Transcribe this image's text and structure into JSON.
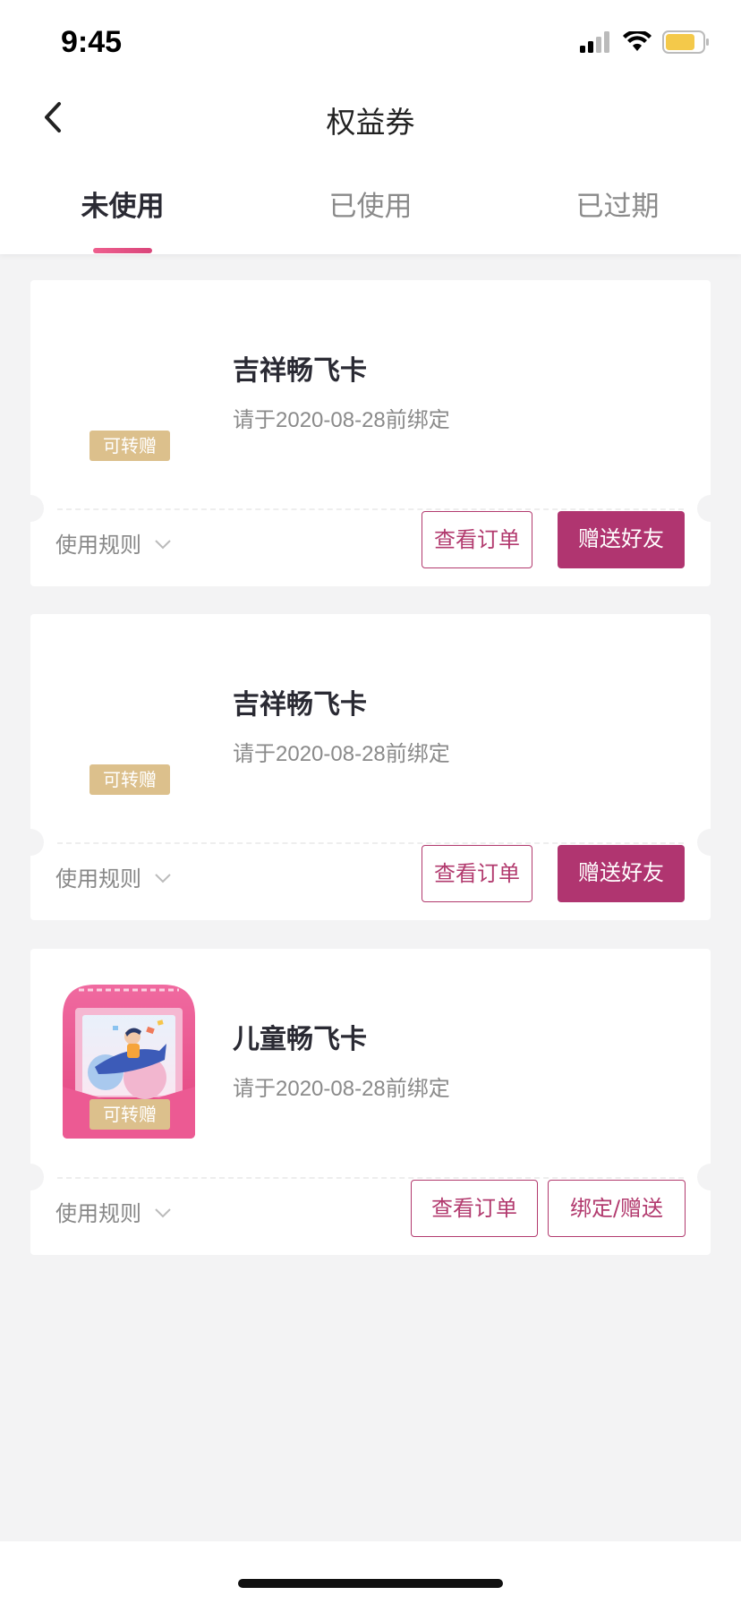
{
  "status": {
    "time": "9:45"
  },
  "header": {
    "title": "权益券"
  },
  "tabs": [
    {
      "label": "未使用",
      "active": true
    },
    {
      "label": "已使用",
      "active": false
    },
    {
      "label": "已过期",
      "active": false
    }
  ],
  "cards": [
    {
      "name": "吉祥畅飞卡",
      "date": "请于2020-08-28前绑定",
      "badge": "可转赠",
      "rules": "使用规则",
      "btn1": "查看订单",
      "btn2": "赠送好友",
      "has_image": false
    },
    {
      "name": "吉祥畅飞卡",
      "date": "请于2020-08-28前绑定",
      "badge": "可转赠",
      "rules": "使用规则",
      "btn1": "查看订单",
      "btn2": "赠送好友",
      "has_image": false
    },
    {
      "name": "儿童畅飞卡",
      "date": "请于2020-08-28前绑定",
      "badge": "可转赠",
      "rules": "使用规则",
      "btn1": "查看订单",
      "btn2": "绑定/赠送",
      "has_image": true
    }
  ],
  "colors": {
    "accent": "#b03570",
    "badge": "#dcc08c",
    "tab_indicator": "#e4528a"
  }
}
